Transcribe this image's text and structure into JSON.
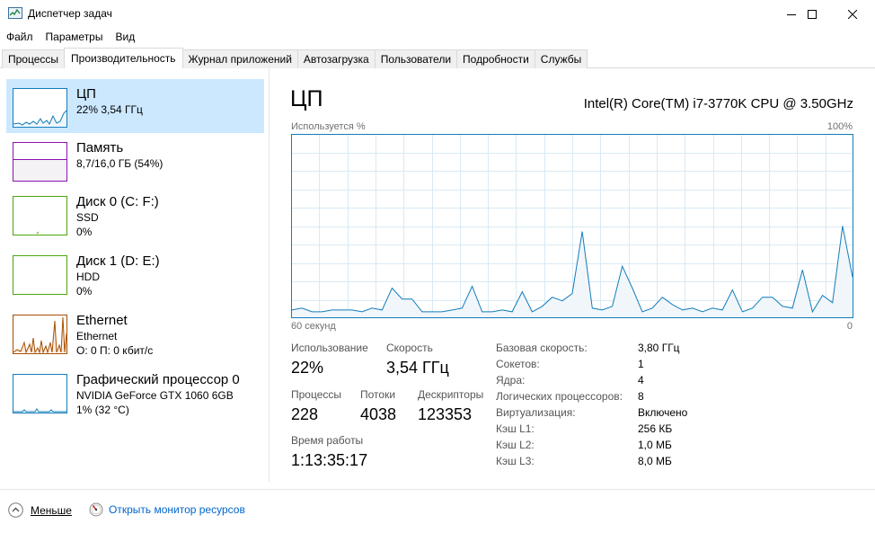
{
  "window": {
    "title": "Диспетчер задач"
  },
  "menu": [
    "Файл",
    "Параметры",
    "Вид"
  ],
  "tabs": [
    "Процессы",
    "Производительность",
    "Журнал приложений",
    "Автозагрузка",
    "Пользователи",
    "Подробности",
    "Службы"
  ],
  "active_tab_index": 1,
  "sidebar": {
    "items": [
      {
        "title": "ЦП",
        "line1": "22% 3,54 ГГц",
        "line2": "",
        "color": "#117dbb",
        "selected": true
      },
      {
        "title": "Память",
        "line1": "8,7/16,0 ГБ (54%)",
        "line2": "",
        "color": "#8b12ae",
        "selected": false
      },
      {
        "title": "Диск 0 (C: F:)",
        "line1": "SSD",
        "line2": "0%",
        "color": "#4da60c",
        "selected": false
      },
      {
        "title": "Диск 1 (D: E:)",
        "line1": "HDD",
        "line2": "0%",
        "color": "#4da60c",
        "selected": false
      },
      {
        "title": "Ethernet",
        "line1": "Ethernet",
        "line2": "О: 0 П: 0 кбит/с",
        "color": "#a74f01",
        "selected": false
      },
      {
        "title": "Графический процессор 0",
        "line1": "NVIDIA GeForce GTX 1060 6GB",
        "line2": "1% (32 °C)",
        "color": "#117dbb",
        "selected": false
      }
    ]
  },
  "main": {
    "title": "ЦП",
    "cpu_model": "Intel(R) Core(TM) i7-3770K CPU @ 3.50GHz",
    "graph": {
      "top_left": "Используется %",
      "top_right": "100%",
      "bottom_left": "60 секунд",
      "bottom_right": "0",
      "line_color": "#117dbb",
      "fill_color": "#f1f6fa",
      "grid_color": "#d9eaf4"
    },
    "stats": {
      "usage_label": "Использование",
      "usage_value": "22%",
      "speed_label": "Скорость",
      "speed_value": "3,54 ГГц",
      "processes_label": "Процессы",
      "processes_value": "228",
      "threads_label": "Потоки",
      "threads_value": "4038",
      "handles_label": "Дескрипторы",
      "handles_value": "123353",
      "uptime_label": "Время работы",
      "uptime_value": "1:13:35:17"
    },
    "info": [
      {
        "label": "Базовая скорость:",
        "value": "3,80 ГГц"
      },
      {
        "label": "Сокетов:",
        "value": "1"
      },
      {
        "label": "Ядра:",
        "value": "4"
      },
      {
        "label": "Логических процессоров:",
        "value": "8"
      },
      {
        "label": "Виртуализация:",
        "value": "Включено"
      },
      {
        "label": "Кэш L1:",
        "value": "256 КБ"
      },
      {
        "label": "Кэш L2:",
        "value": "1,0 МБ"
      },
      {
        "label": "Кэш L3:",
        "value": "8,0 МБ"
      }
    ]
  },
  "footer": {
    "less_label": "Меньше",
    "monitor_label": "Открыть монитор ресурсов"
  },
  "cpu_history_percent": [
    4,
    5,
    3,
    3,
    4,
    4,
    4,
    3,
    5,
    4,
    16,
    10,
    10,
    3,
    3,
    3,
    4,
    5,
    17,
    3,
    3,
    4,
    3,
    14,
    3,
    6,
    11,
    9,
    13,
    47,
    5,
    4,
    6,
    28,
    16,
    3,
    5,
    11,
    7,
    4,
    5,
    3,
    5,
    4,
    15,
    3,
    5,
    11,
    11,
    6,
    5,
    26,
    3,
    12,
    8,
    50,
    22
  ]
}
